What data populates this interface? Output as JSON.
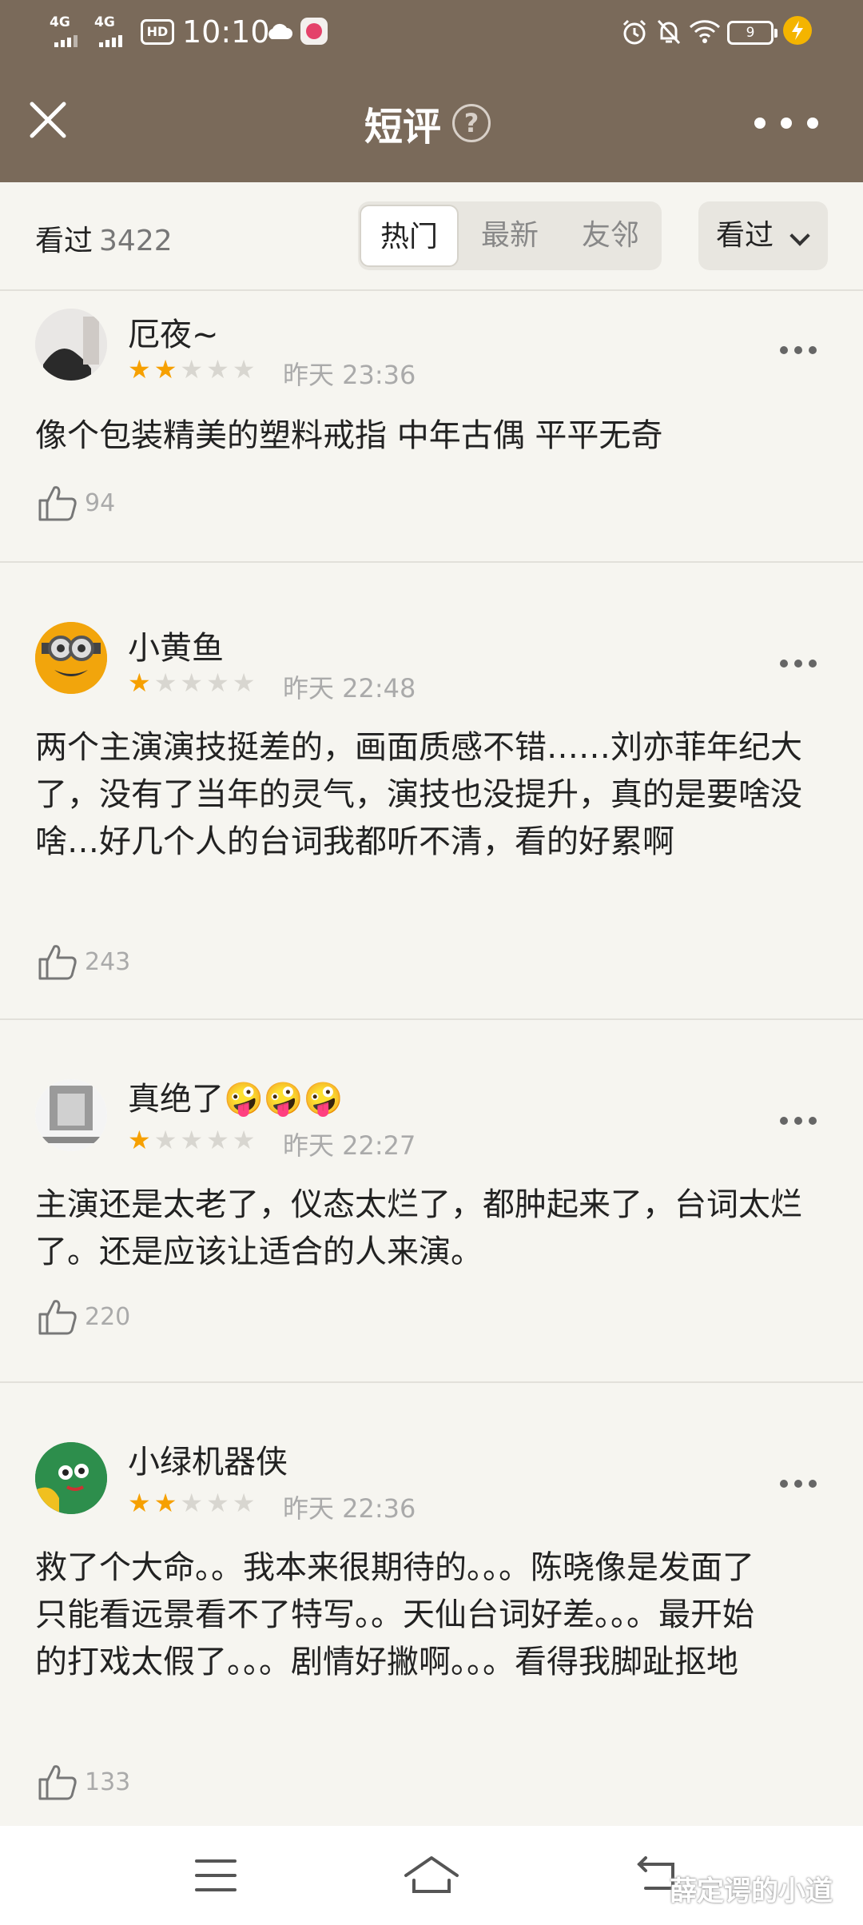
{
  "status_bar": {
    "network1": "4G",
    "network2": "4G",
    "hd_label": "HD",
    "time": "10:10",
    "battery": "9"
  },
  "header": {
    "title": "短评",
    "help_symbol": "?"
  },
  "filter": {
    "watched_label": "看过",
    "watched_count": "3422",
    "tabs": [
      "热门",
      "最新",
      "友邻"
    ],
    "active_tab": "热门",
    "dropdown_label": "看过"
  },
  "reviews": [
    {
      "name": "厄夜~",
      "stars": 2,
      "time": "昨天 23:36",
      "text": "像个包装精美的塑料戒指 中年古偶 平平无奇",
      "likes": "94"
    },
    {
      "name": "小黄鱼",
      "stars": 1,
      "time": "昨天 22:48",
      "text": "两个主演演技挺差的，画面质感不错……刘亦菲年纪大了，没有了当年的灵气，演技也没提升，真的是要啥没啥…好几个人的台词我都听不清，看的好累啊",
      "likes": "243"
    },
    {
      "name": "真绝了🤪🤪🤪",
      "stars": 1,
      "time": "昨天 22:27",
      "text": "主演还是太老了，仪态太烂了，都肿起来了，台词太烂了。还是应该让适合的人来演。",
      "likes": "220"
    },
    {
      "name": "小绿机器侠",
      "stars": 2,
      "time": "昨天 22:36",
      "text": "救了个大命。。我本来很期待的。。。陈晓像是发面了只能看远景看不了特写。。天仙台词好差。。。最开始的打戏太假了。。。剧情好撇啊。。。看得我脚趾抠地",
      "likes": "133"
    }
  ],
  "watermark": "薛定谔的小道",
  "colors": {
    "header_bg": "#7a6a5a",
    "page_bg": "#f6f5f0",
    "star_on": "#f6a000",
    "star_off": "#d8d6d0"
  }
}
